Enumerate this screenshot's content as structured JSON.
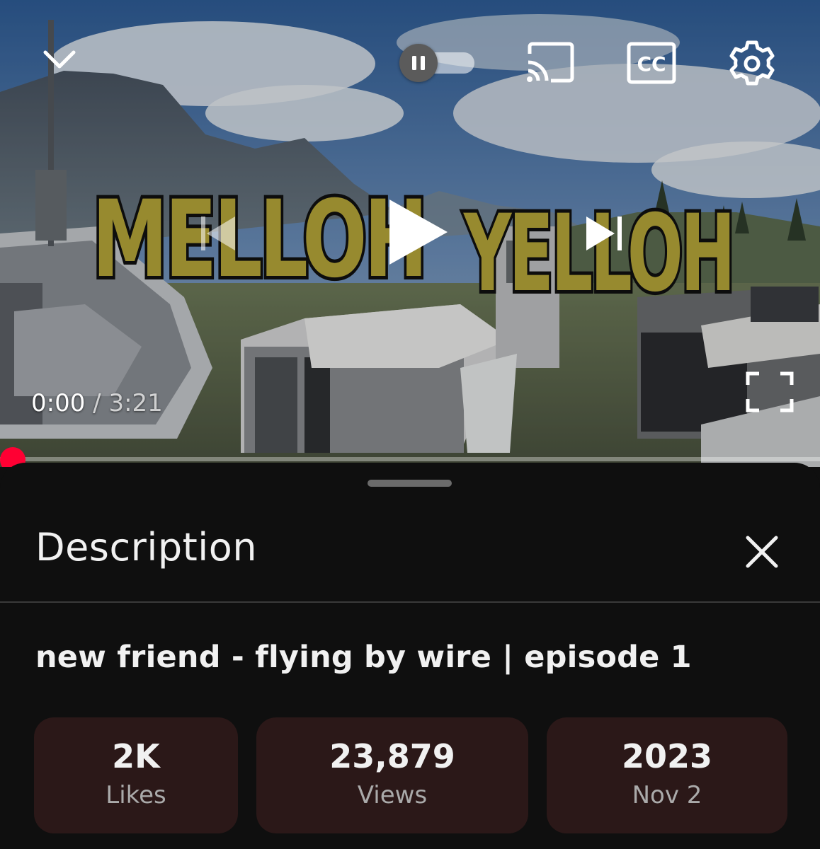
{
  "player": {
    "overlay_text": "MELLOH YELLOH",
    "current_time": "0:00",
    "separator": " / ",
    "duration": "3:21",
    "progress_fraction": 0.0,
    "accent_color": "#ff0033",
    "autoplay": "on",
    "icons": [
      "chevron-down-icon",
      "pause-icon",
      "cast-icon",
      "cc-icon",
      "gear-icon",
      "previous-icon",
      "play-icon",
      "next-icon",
      "fullscreen-icon"
    ]
  },
  "sheet": {
    "title": "Description",
    "close_icon": "close-icon"
  },
  "video": {
    "title": "new friend - flying by wire | episode 1"
  },
  "stats": {
    "likes": {
      "value": "2K",
      "label": "Likes"
    },
    "views": {
      "value": "23,879",
      "label": "Views"
    },
    "date": {
      "value": "2023",
      "label": "Nov 2"
    }
  },
  "colors": {
    "background": "#0f0f0f",
    "stat_card": "#2b1818",
    "text_primary": "#f1f1f1",
    "text_secondary": "#aaaaaa",
    "overlay_yellow": "#b9a93a"
  }
}
